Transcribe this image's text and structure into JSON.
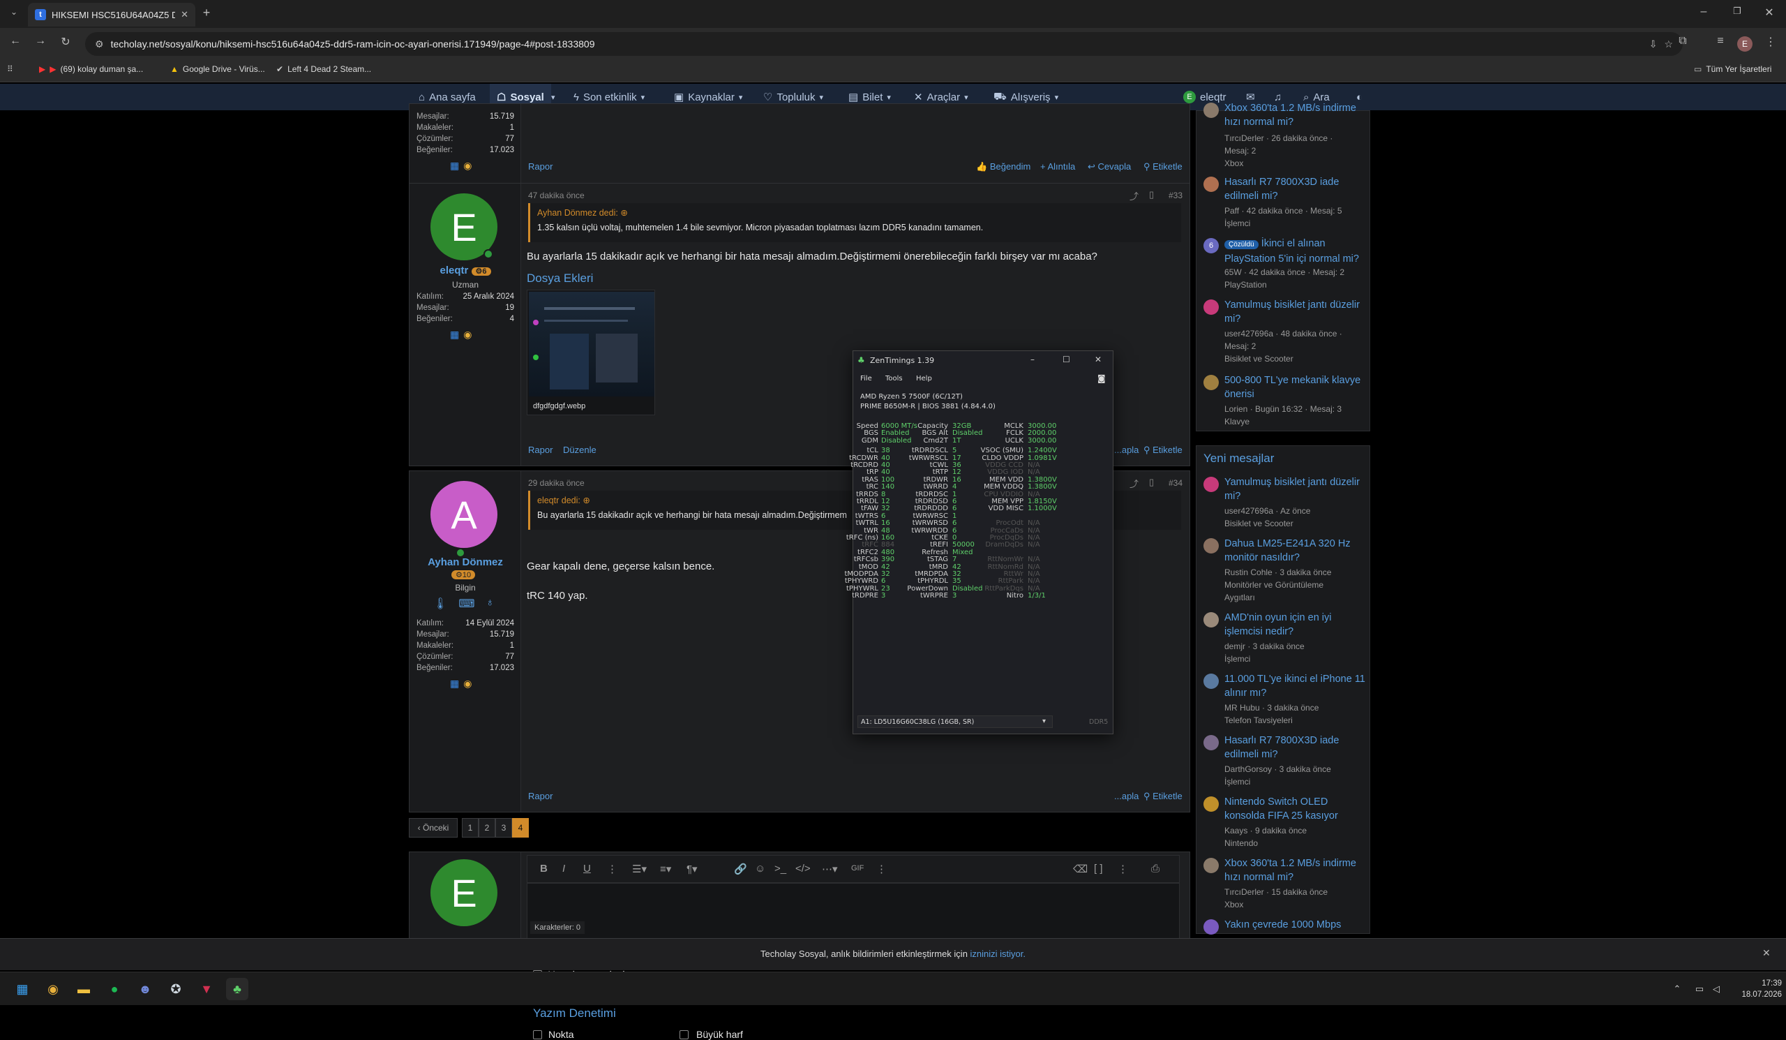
{
  "browser": {
    "tab_title": "HIKSEMI HSC516U64A04Z5 DD",
    "url": "techolay.net/sosyal/konu/hiksemi-hsc516u64a04z5-ddr5-ram-icin-oc-ayari-onerisi.171949/page-4#post-1833809",
    "bookmarks": [
      "(69) kolay duman şa...",
      "Google Drive - Virüs...",
      "Left 4 Dead 2 Steam..."
    ],
    "all_bookmarks": "Tüm Yer İşaretleri",
    "profile_initial": "E"
  },
  "nav": {
    "items": [
      "Ana sayfa",
      "Sosyal",
      "Son etkinlik",
      "Kaynaklar",
      "Topluluk",
      "Bilet",
      "Araçlar",
      "Alışveriş"
    ],
    "user": "eleqtr",
    "search": "Ara"
  },
  "post_top": {
    "stats": [
      {
        "k": "Mesajlar:",
        "v": "15.719"
      },
      {
        "k": "Makaleler:",
        "v": "1"
      },
      {
        "k": "Çözümler:",
        "v": "77"
      },
      {
        "k": "Beğeniler:",
        "v": "17.023"
      }
    ],
    "rapor": "Rapor",
    "actions": [
      "Beğendim",
      "+ Alıntıla",
      "Cevapla",
      "Etiketle"
    ]
  },
  "post33": {
    "avatar_letter": "E",
    "username": "eleqtr",
    "badge": "6",
    "role": "Uzman",
    "stats": [
      {
        "k": "Katılım:",
        "v": "25 Aralık 2024"
      },
      {
        "k": "Mesajlar:",
        "v": "19"
      },
      {
        "k": "Beğeniler:",
        "v": "4"
      }
    ],
    "time": "47 dakika önce",
    "number": "#33",
    "quote_author": "Ayhan Dönmez dedi:",
    "quote_text": "1.35 kalsın üçlü voltaj, muhtemelen 1.4 bile sevmiyor. Micron piyasadan toplatması lazım DDR5 kanadını tamamen.",
    "body": "Bu ayarlarla 15 dakikadır açık ve herhangi bir hata mesajı almadım.Değiştirmemi önerebileceğin farklı birşey var mı acaba?",
    "attachments_title": "Dosya Ekleri",
    "attachment_name": "dfgdfgdgf.webp",
    "links": [
      "Rapor",
      "Düzenle"
    ],
    "actions": [
      "...apla",
      "Etiketle"
    ]
  },
  "post34": {
    "avatar_letter": "A",
    "username": "Ayhan Dönmez",
    "badge": "10",
    "role": "Bilgin",
    "stats": [
      {
        "k": "Katılım:",
        "v": "14 Eylül 2024"
      },
      {
        "k": "Mesajlar:",
        "v": "15.719"
      },
      {
        "k": "Makaleler:",
        "v": "1"
      },
      {
        "k": "Çözümler:",
        "v": "77"
      },
      {
        "k": "Beğeniler:",
        "v": "17.023"
      }
    ],
    "time": "29 dakika önce",
    "number": "#34",
    "quote_author": "eleqtr dedi:",
    "quote_text": "Bu ayarlarla 15 dakikadır açık ve herhangi bir hata mesajı almadım.Değiştirmem",
    "body1": "Gear kapalı dene, geçerse kalsın bence.",
    "body2": "tRC 140 yap.",
    "rapor": "Rapor",
    "actions": [
      "...apla",
      "Etiketle"
    ]
  },
  "pagination": {
    "prev": "‹ Önceki",
    "pages": [
      "1",
      "2",
      "3",
      "4"
    ],
    "current": "4"
  },
  "editor": {
    "avatar_letter": "E",
    "char_count": "Karakterler: 0",
    "schedule": "Yayınlamayı planla...",
    "spellcheck_title": "Yazım Denetimi",
    "options": [
      "Nokta",
      "Büyük harf"
    ]
  },
  "sidebar_top": [
    {
      "title": "Xbox 360'ta 1.2 MB/s indirme hızı normal mi?",
      "meta1": "TırcıDerler · 26 dakika önce ·",
      "meta2": "Mesaj: 2",
      "meta3": "Xbox"
    },
    {
      "title": "Hasarlı R7 7800X3D iade edilmeli mi?",
      "meta1": "Paff · 42 dakika önce · Mesaj: 5",
      "meta2": "İşlemci"
    },
    {
      "badge": "Çözüldü",
      "title": "İkinci el alınan PlayStation 5'in içi normal mi?",
      "meta1": "65W · 42 dakika önce · Mesaj: 2",
      "meta2": "PlayStation"
    },
    {
      "title": "Yamulmuş bisiklet jantı düzelir mi?",
      "meta1": "user427696a · 48 dakika önce ·",
      "meta2": "Mesaj: 2",
      "meta3": "Bisiklet ve Scooter"
    },
    {
      "title": "500-800 TL'ye mekanik klavye önerisi",
      "meta1": "Lorien · Bugün 16:32 · Mesaj: 3",
      "meta2": "Klavye"
    }
  ],
  "sidebar_new_title": "Yeni mesajlar",
  "sidebar_new": [
    {
      "title": "Yamulmuş bisiklet jantı düzelir mi?",
      "meta1": "user427696a · Az önce",
      "meta2": "Bisiklet ve Scooter"
    },
    {
      "title": "Dahua LM25-E241A 320 Hz monitör nasıldır?",
      "meta1": "Rustin Cohle · 3 dakika önce",
      "meta2": "Monitörler ve Görüntüleme",
      "meta3": "Aygıtları"
    },
    {
      "title": "AMD'nin oyun için en iyi işlemcisi nedir?",
      "meta1": "demjr · 3 dakika önce",
      "meta2": "İşlemci"
    },
    {
      "title": "11.000 TL'ye ikinci el iPhone 11 alınır mı?",
      "meta1": "MR Hubu · 3 dakika önce",
      "meta2": "Telefon Tavsiyeleri"
    },
    {
      "title": "Hasarlı R7 7800X3D iade edilmeli mi?",
      "meta1": "DarthGorsoy · 3 dakika önce",
      "meta2": "İşlemci"
    },
    {
      "title": "Nintendo Switch OLED konsolda FIFA 25 kasıyor",
      "meta1": "Kaays · 9 dakika önce",
      "meta2": "Nintendo"
    },
    {
      "title": "Xbox 360'ta 1.2 MB/s indirme hızı normal mi?",
      "meta1": "TırcıDerler · 15 dakika önce",
      "meta2": "Xbox"
    },
    {
      "title": "Yakın çevrede 1000 Mbps",
      "meta1": "",
      "meta2": ""
    }
  ],
  "zen": {
    "title": "ZenTimings 1.39",
    "menu": [
      "File",
      "Tools",
      "Help"
    ],
    "cpu": "AMD Ryzen 5 7500F (6C/12T)",
    "board": "PRIME B650M-R | BIOS 3881 (4.84.4.0)",
    "top": [
      [
        "Speed",
        "6000 MT/s",
        "Capacity",
        "32GB",
        "MCLK",
        "3000.00"
      ],
      [
        "BGS",
        "Enabled",
        "BGS Alt",
        "Disabled",
        "FCLK",
        "2000.00"
      ],
      [
        "GDM",
        "Disabled",
        "Cmd2T",
        "1T",
        "UCLK",
        "3000.00"
      ]
    ],
    "rows": [
      [
        "tCL",
        "38",
        "tRDRDSCL",
        "5",
        "VSOC (SMU)",
        "1.2400V"
      ],
      [
        "tRCDWR",
        "40",
        "tWRWRSCL",
        "17",
        "CLDO VDDP",
        "1.0981V"
      ],
      [
        "tRCDRD",
        "40",
        "tCWL",
        "36",
        "VDDG CCD",
        "N/A"
      ],
      [
        "tRP",
        "40",
        "tRTP",
        "12",
        "VDDG IOD",
        "N/A"
      ],
      [
        "tRAS",
        "100",
        "tRDWR",
        "16",
        "MEM VDD",
        "1.3800V"
      ],
      [
        "tRC",
        "140",
        "tWRRD",
        "4",
        "MEM VDDQ",
        "1.3800V"
      ],
      [
        "tRRDS",
        "8",
        "tRDRDSC",
        "1",
        "CPU VDDIO",
        "N/A"
      ],
      [
        "tRRDL",
        "12",
        "tRDRDSD",
        "6",
        "MEM VPP",
        "1.8150V"
      ],
      [
        "tFAW",
        "32",
        "tRDRDDD",
        "6",
        "VDD MISC",
        "1.1000V"
      ],
      [
        "tWTRS",
        "6",
        "tWRWRSC",
        "1",
        "",
        ""
      ],
      [
        "tWTRL",
        "16",
        "tWRWRSD",
        "6",
        "ProcOdt",
        "N/A"
      ],
      [
        "tWR",
        "48",
        "tWRWRDD",
        "6",
        "ProcCaDs",
        "N/A"
      ],
      [
        "tRFC (ns)",
        "160",
        "tCKE",
        "0",
        "ProcDqDs",
        "N/A"
      ],
      [
        "tRFC",
        "884",
        "tREFI",
        "50000",
        "DramDqDs",
        "N/A"
      ],
      [
        "tRFC2",
        "480",
        "Refresh",
        "Mixed",
        "",
        ""
      ],
      [
        "tRFCsb",
        "390",
        "tSTAG",
        "7",
        "RttNomWr",
        "N/A"
      ],
      [
        "tMOD",
        "42",
        "tMRD",
        "42",
        "RttNomRd",
        "N/A"
      ],
      [
        "tMODPDA",
        "32",
        "tMRDPDA",
        "32",
        "RttWr",
        "N/A"
      ],
      [
        "tPHYWRD",
        "6",
        "tPHYRDL",
        "35",
        "RttPark",
        "N/A"
      ],
      [
        "tPHYWRL",
        "23",
        "PowerDown",
        "Disabled",
        "RttParkDqs",
        "N/A"
      ],
      [
        "tRDPRE",
        "3",
        "tWRPRE",
        "3",
        "Nitro",
        "1/3/1"
      ]
    ],
    "module": "A1: LD5U16G60C38LG (16GB, SR)",
    "ddr": "DDR5"
  },
  "notification": {
    "text": "Techolay Sosyal, anlık bildirimleri etkinleştirmek için ",
    "link": "izninizi istiyor."
  },
  "taskbar": {
    "time": "17:39",
    "date": "18.07.2026"
  }
}
